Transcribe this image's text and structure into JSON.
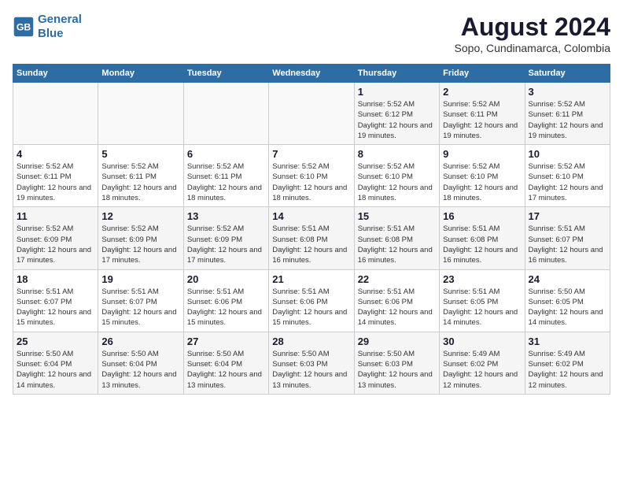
{
  "header": {
    "logo_line1": "General",
    "logo_line2": "Blue",
    "title": "August 2024",
    "subtitle": "Sopo, Cundinamarca, Colombia"
  },
  "days_of_week": [
    "Sunday",
    "Monday",
    "Tuesday",
    "Wednesday",
    "Thursday",
    "Friday",
    "Saturday"
  ],
  "weeks": [
    [
      {
        "day": "",
        "info": ""
      },
      {
        "day": "",
        "info": ""
      },
      {
        "day": "",
        "info": ""
      },
      {
        "day": "",
        "info": ""
      },
      {
        "day": "1",
        "info": "Sunrise: 5:52 AM\nSunset: 6:12 PM\nDaylight: 12 hours\nand 19 minutes."
      },
      {
        "day": "2",
        "info": "Sunrise: 5:52 AM\nSunset: 6:11 PM\nDaylight: 12 hours\nand 19 minutes."
      },
      {
        "day": "3",
        "info": "Sunrise: 5:52 AM\nSunset: 6:11 PM\nDaylight: 12 hours\nand 19 minutes."
      }
    ],
    [
      {
        "day": "4",
        "info": "Sunrise: 5:52 AM\nSunset: 6:11 PM\nDaylight: 12 hours\nand 19 minutes."
      },
      {
        "day": "5",
        "info": "Sunrise: 5:52 AM\nSunset: 6:11 PM\nDaylight: 12 hours\nand 18 minutes."
      },
      {
        "day": "6",
        "info": "Sunrise: 5:52 AM\nSunset: 6:11 PM\nDaylight: 12 hours\nand 18 minutes."
      },
      {
        "day": "7",
        "info": "Sunrise: 5:52 AM\nSunset: 6:10 PM\nDaylight: 12 hours\nand 18 minutes."
      },
      {
        "day": "8",
        "info": "Sunrise: 5:52 AM\nSunset: 6:10 PM\nDaylight: 12 hours\nand 18 minutes."
      },
      {
        "day": "9",
        "info": "Sunrise: 5:52 AM\nSunset: 6:10 PM\nDaylight: 12 hours\nand 18 minutes."
      },
      {
        "day": "10",
        "info": "Sunrise: 5:52 AM\nSunset: 6:10 PM\nDaylight: 12 hours\nand 17 minutes."
      }
    ],
    [
      {
        "day": "11",
        "info": "Sunrise: 5:52 AM\nSunset: 6:09 PM\nDaylight: 12 hours\nand 17 minutes."
      },
      {
        "day": "12",
        "info": "Sunrise: 5:52 AM\nSunset: 6:09 PM\nDaylight: 12 hours\nand 17 minutes."
      },
      {
        "day": "13",
        "info": "Sunrise: 5:52 AM\nSunset: 6:09 PM\nDaylight: 12 hours\nand 17 minutes."
      },
      {
        "day": "14",
        "info": "Sunrise: 5:51 AM\nSunset: 6:08 PM\nDaylight: 12 hours\nand 16 minutes."
      },
      {
        "day": "15",
        "info": "Sunrise: 5:51 AM\nSunset: 6:08 PM\nDaylight: 12 hours\nand 16 minutes."
      },
      {
        "day": "16",
        "info": "Sunrise: 5:51 AM\nSunset: 6:08 PM\nDaylight: 12 hours\nand 16 minutes."
      },
      {
        "day": "17",
        "info": "Sunrise: 5:51 AM\nSunset: 6:07 PM\nDaylight: 12 hours\nand 16 minutes."
      }
    ],
    [
      {
        "day": "18",
        "info": "Sunrise: 5:51 AM\nSunset: 6:07 PM\nDaylight: 12 hours\nand 15 minutes."
      },
      {
        "day": "19",
        "info": "Sunrise: 5:51 AM\nSunset: 6:07 PM\nDaylight: 12 hours\nand 15 minutes."
      },
      {
        "day": "20",
        "info": "Sunrise: 5:51 AM\nSunset: 6:06 PM\nDaylight: 12 hours\nand 15 minutes."
      },
      {
        "day": "21",
        "info": "Sunrise: 5:51 AM\nSunset: 6:06 PM\nDaylight: 12 hours\nand 15 minutes."
      },
      {
        "day": "22",
        "info": "Sunrise: 5:51 AM\nSunset: 6:06 PM\nDaylight: 12 hours\nand 14 minutes."
      },
      {
        "day": "23",
        "info": "Sunrise: 5:51 AM\nSunset: 6:05 PM\nDaylight: 12 hours\nand 14 minutes."
      },
      {
        "day": "24",
        "info": "Sunrise: 5:50 AM\nSunset: 6:05 PM\nDaylight: 12 hours\nand 14 minutes."
      }
    ],
    [
      {
        "day": "25",
        "info": "Sunrise: 5:50 AM\nSunset: 6:04 PM\nDaylight: 12 hours\nand 14 minutes."
      },
      {
        "day": "26",
        "info": "Sunrise: 5:50 AM\nSunset: 6:04 PM\nDaylight: 12 hours\nand 13 minutes."
      },
      {
        "day": "27",
        "info": "Sunrise: 5:50 AM\nSunset: 6:04 PM\nDaylight: 12 hours\nand 13 minutes."
      },
      {
        "day": "28",
        "info": "Sunrise: 5:50 AM\nSunset: 6:03 PM\nDaylight: 12 hours\nand 13 minutes."
      },
      {
        "day": "29",
        "info": "Sunrise: 5:50 AM\nSunset: 6:03 PM\nDaylight: 12 hours\nand 13 minutes."
      },
      {
        "day": "30",
        "info": "Sunrise: 5:49 AM\nSunset: 6:02 PM\nDaylight: 12 hours\nand 12 minutes."
      },
      {
        "day": "31",
        "info": "Sunrise: 5:49 AM\nSunset: 6:02 PM\nDaylight: 12 hours\nand 12 minutes."
      }
    ]
  ]
}
